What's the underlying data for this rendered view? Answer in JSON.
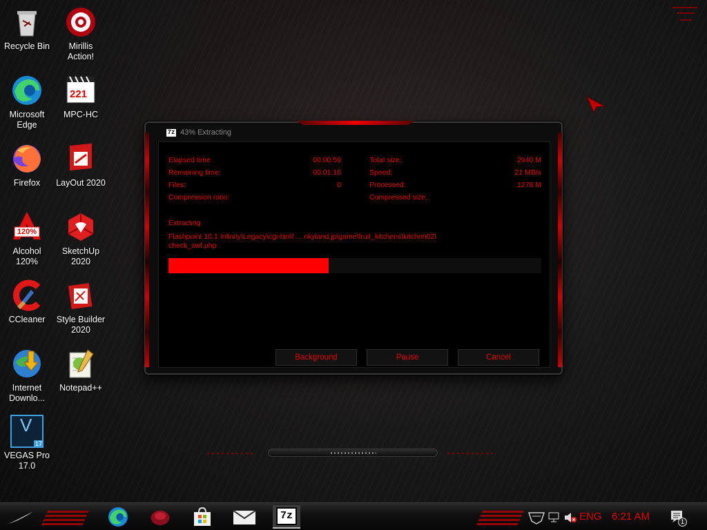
{
  "desktop": {
    "icons": [
      {
        "label_line1": "Recycle Bin",
        "label_line2": "",
        "icon": "recycle-bin-icon"
      },
      {
        "label_line1": "Mirillis",
        "label_line2": "Action!",
        "icon": "mirillis-action-icon"
      },
      {
        "label_line1": "Microsoft",
        "label_line2": "Edge",
        "icon": "edge-icon"
      },
      {
        "label_line1": "MPC-HC",
        "label_line2": "",
        "icon": "mpc-hc-icon"
      },
      {
        "label_line1": "Firefox",
        "label_line2": "",
        "icon": "firefox-icon"
      },
      {
        "label_line1": "LayOut 2020",
        "label_line2": "",
        "icon": "layout-icon"
      },
      {
        "label_line1": "Alcohol",
        "label_line2": "120%",
        "icon": "alcohol-icon"
      },
      {
        "label_line1": "SketchUp",
        "label_line2": "2020",
        "icon": "sketchup-icon"
      },
      {
        "label_line1": "CCleaner",
        "label_line2": "",
        "icon": "ccleaner-icon"
      },
      {
        "label_line1": "Style Builder",
        "label_line2": "2020",
        "icon": "style-builder-icon"
      },
      {
        "label_line1": "Internet",
        "label_line2": "Downlo...",
        "icon": "idm-icon"
      },
      {
        "label_line1": "Notepad++",
        "label_line2": "",
        "icon": "notepadpp-icon"
      },
      {
        "label_line1": "VEGAS Pro",
        "label_line2": "17.0",
        "icon": "vegas-pro-icon"
      }
    ],
    "mpc_badge": "221",
    "alcohol_badge": "120%",
    "vegas_letter": "V",
    "vegas_version": "17"
  },
  "dialog": {
    "app_logo": "7z",
    "title": "43% Extracting",
    "progress_percent": 43,
    "left_stats": [
      {
        "label": "Elapsed time:",
        "value": "00:00:59"
      },
      {
        "label": "Remaining time:",
        "value": "00:01:16"
      },
      {
        "label": "Files:",
        "value": "0"
      },
      {
        "label": "Compression ratio:",
        "value": ""
      }
    ],
    "right_stats": [
      {
        "label": "Total size:",
        "value": "2940 M"
      },
      {
        "label": "Speed:",
        "value": "21 MB/s"
      },
      {
        "label": "Processed:",
        "value": "1278 M"
      },
      {
        "label": "Compressed size:",
        "value": ""
      }
    ],
    "operation_label": "Extracting",
    "current_path_line1": "Flashpoint 10.1 Infinity\\Legacy\\cgi-bin\\f ... nkyland.jp\\game\\fruit_kitchens\\kitchen02\\",
    "current_path_line2": "check_swf.php",
    "buttons": {
      "background": "Background",
      "pause": "Pause",
      "cancel": "Cancel"
    }
  },
  "taskbar": {
    "pinned": [
      {
        "name": "edge"
      },
      {
        "name": "mirillis-action"
      },
      {
        "name": "microsoft-store"
      },
      {
        "name": "mail"
      },
      {
        "name": "7zip",
        "label": "7z",
        "active": true
      }
    ],
    "language": "ENG",
    "time": "6:21 AM",
    "notification_count": "1"
  },
  "colors": {
    "accent_red": "#e00000",
    "progress_red": "#ff0000"
  }
}
